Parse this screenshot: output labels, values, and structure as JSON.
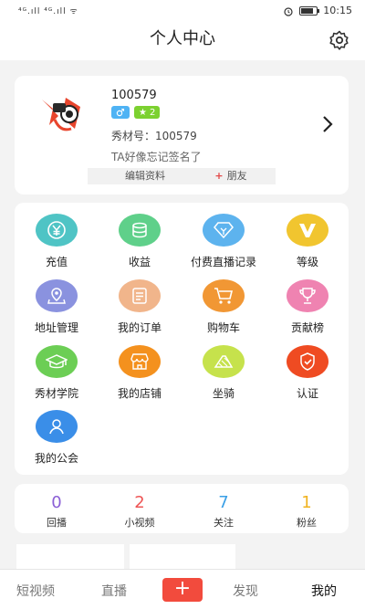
{
  "status": {
    "signal_text": "⁴ᴳ.ıll ⁴ᴳ.ıll ᯤ",
    "time": "10:15",
    "battery": 0.8
  },
  "header": {
    "title": "个人中心"
  },
  "profile": {
    "id": "100579",
    "level": "2",
    "account": "秀材号：100579",
    "signature": "TA好像忘记签名了",
    "edit_label": "编辑资料",
    "friend_label": "朋友",
    "friend_plus": "+"
  },
  "menu": [
    {
      "label": "充值",
      "icon": "yuan-icon",
      "color": "#4fc4c5"
    },
    {
      "label": "收益",
      "icon": "coins-icon",
      "color": "#5fd08a"
    },
    {
      "label": "付费直播记录",
      "icon": "diamond-icon",
      "color": "#5db3ee"
    },
    {
      "label": "等级",
      "icon": "v-icon",
      "color": "#f1c52f"
    },
    {
      "label": "地址管理",
      "icon": "location-icon",
      "color": "#8a92df"
    },
    {
      "label": "我的订单",
      "icon": "order-icon",
      "color": "#f1b58b"
    },
    {
      "label": "购物车",
      "icon": "cart-icon",
      "color": "#f19734"
    },
    {
      "label": "贡献榜",
      "icon": "trophy-icon",
      "color": "#ef83b1"
    },
    {
      "label": "秀材学院",
      "icon": "graduation-cap-icon",
      "color": "#6cce55"
    },
    {
      "label": "我的店铺",
      "icon": "shop-icon",
      "color": "#f4911e"
    },
    {
      "label": "坐骑",
      "icon": "vehicle-icon",
      "color": "#c6e24c"
    },
    {
      "label": "认证",
      "icon": "shield-icon",
      "color": "#ef4b22"
    },
    {
      "label": "我的公会",
      "icon": "user-icon",
      "color": "#3a8ee8"
    }
  ],
  "stats": [
    {
      "value": "0",
      "label": "回播",
      "color": "#8b5fd6"
    },
    {
      "value": "2",
      "label": "小视频",
      "color": "#ee5454"
    },
    {
      "value": "7",
      "label": "关注",
      "color": "#3a9fe6"
    },
    {
      "value": "1",
      "label": "粉丝",
      "color": "#f0b320"
    }
  ],
  "tabs": {
    "short_video": "短视频",
    "live": "直播",
    "plus": "+",
    "discover": "发现",
    "mine": "我的"
  }
}
